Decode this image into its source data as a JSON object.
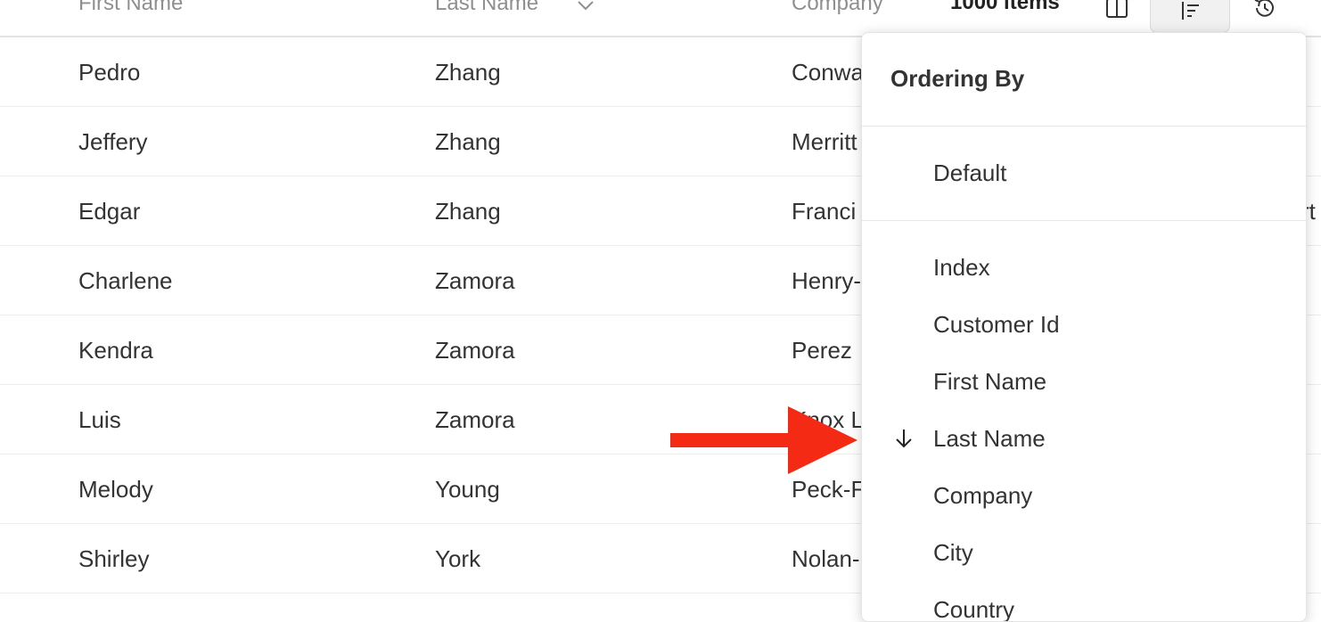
{
  "header": {
    "col_first": "First Name",
    "col_last": "Last Name",
    "col_company": "Company",
    "item_count": "1000 items"
  },
  "rows": [
    {
      "first": "Pedro",
      "last": "Zhang",
      "company": "Conwa",
      "extra": ""
    },
    {
      "first": "Jeffery",
      "last": "Zhang",
      "company": "Merritt",
      "extra": ""
    },
    {
      "first": "Edgar",
      "last": "Zhang",
      "company": "Franci",
      "extra": "rt"
    },
    {
      "first": "Charlene",
      "last": "Zamora",
      "company": "Henry-",
      "extra": ""
    },
    {
      "first": "Kendra",
      "last": "Zamora",
      "company": "Perez",
      "extra": ""
    },
    {
      "first": "Luis",
      "last": "Zamora",
      "company": "Knox L",
      "extra": ""
    },
    {
      "first": "Melody",
      "last": "Young",
      "company": "Peck-F",
      "extra": ""
    },
    {
      "first": "Shirley",
      "last": "York",
      "company": "Nolan-",
      "extra": ""
    }
  ],
  "ordering": {
    "title": "Ordering By",
    "default_label": "Default",
    "items": [
      {
        "label": "Index",
        "active": false
      },
      {
        "label": "Customer Id",
        "active": false
      },
      {
        "label": "First Name",
        "active": false
      },
      {
        "label": "Last Name",
        "active": true
      },
      {
        "label": "Company",
        "active": false
      },
      {
        "label": "City",
        "active": false
      },
      {
        "label": "Country",
        "active": false
      }
    ]
  },
  "icons": {
    "sort_column": "chevron-down-icon",
    "columns": "columns-icon",
    "ordering": "sort-order-icon",
    "history": "history-icon",
    "active_sort": "arrow-down-icon",
    "annotation": "red-arrow-icon"
  },
  "colors": {
    "annotation_arrow": "#f52a14",
    "header_text": "#8f8f8f",
    "text": "#333333"
  }
}
